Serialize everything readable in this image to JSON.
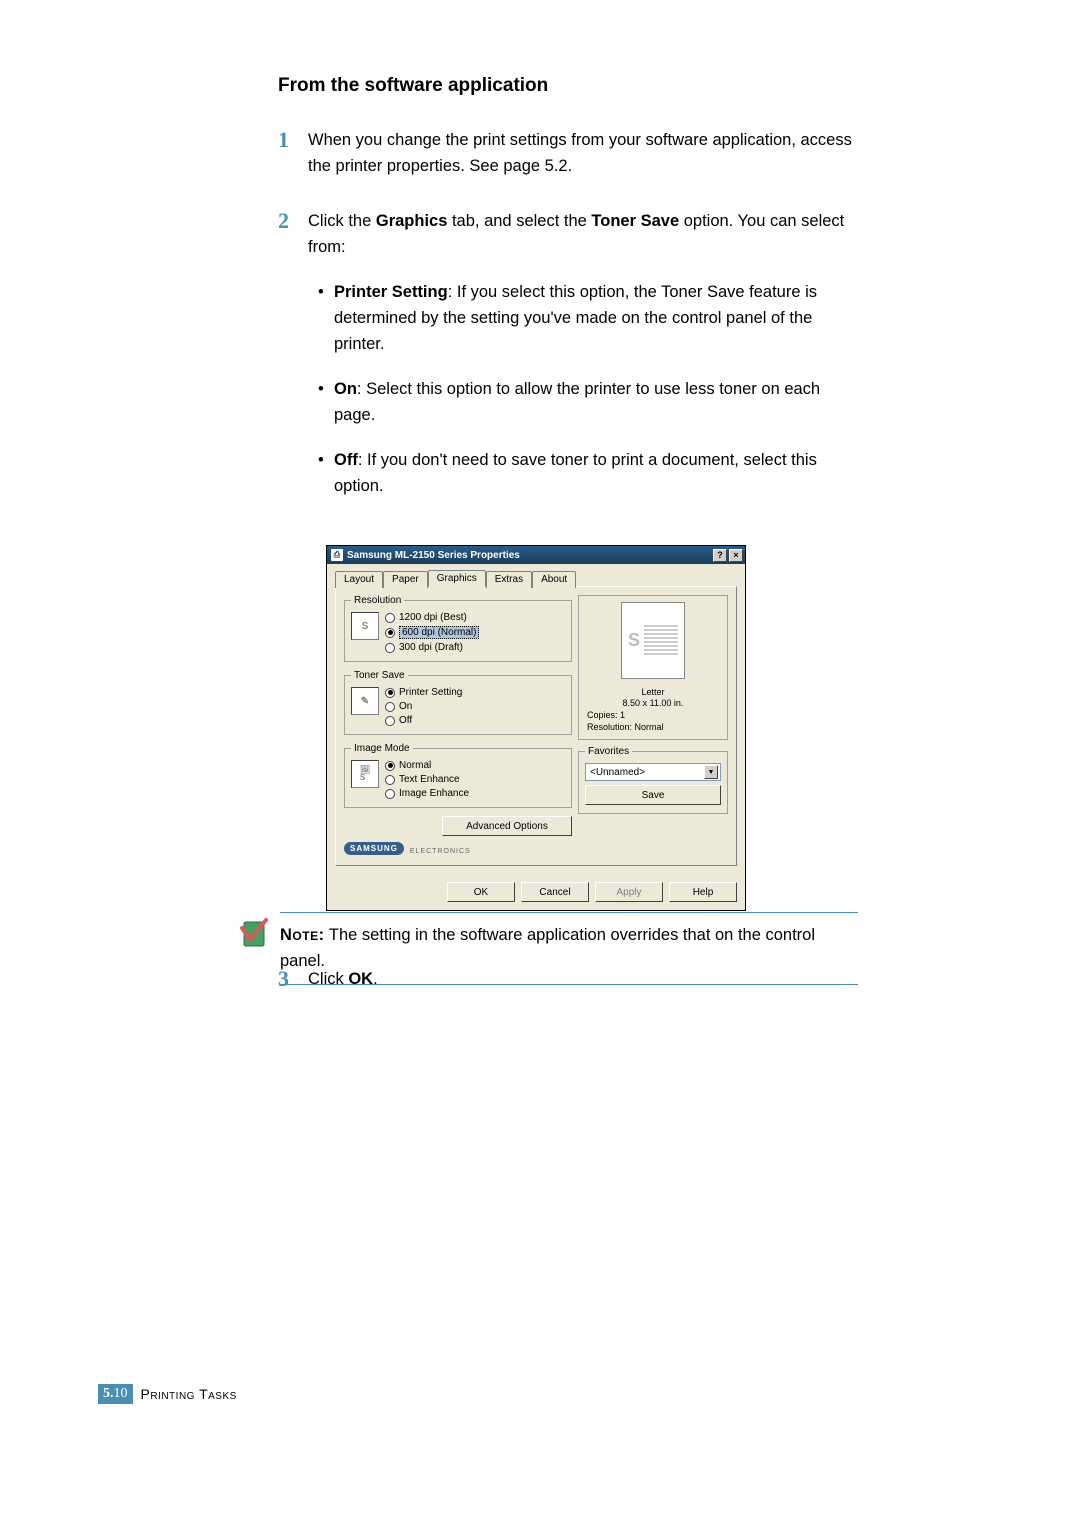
{
  "heading": "From the software application",
  "steps": {
    "s1": {
      "num": "1",
      "text": "When you change the print settings from your software application, access the printer properties. See page 5.2."
    },
    "s2": {
      "num": "2",
      "text_a": "Click the ",
      "text_b": "Graphics",
      "text_c": " tab, and select the ",
      "text_d": "Toner Save",
      "text_e": " option. You can select from:",
      "bullets": {
        "b1": {
          "label": "Printer Setting",
          "rest": ": If you select this option, the Toner Save feature is determined by the setting you've made on the control panel of the printer."
        },
        "b2": {
          "label": "On",
          "rest": ": Select this option to allow the printer to use less toner on each page."
        },
        "b3": {
          "label": "Off",
          "rest": ": If you don't need to save toner to print a document, select this option."
        }
      }
    },
    "s3": {
      "num": "3",
      "text_a": "Click ",
      "text_b": "OK",
      "text_c": "."
    }
  },
  "dialog": {
    "title": "Samsung ML-2150 Series Properties",
    "help_btn": "?",
    "close_btn": "×",
    "tabs": {
      "layout": "Layout",
      "paper": "Paper",
      "graphics": "Graphics",
      "extras": "Extras",
      "about": "About"
    },
    "groups": {
      "resolution": {
        "legend": "Resolution",
        "items": {
          "r1": "1200 dpi (Best)",
          "r2": "600 dpi (Normal)",
          "r3": "300 dpi (Draft)"
        }
      },
      "toner": {
        "legend": "Toner Save",
        "items": {
          "t1": "Printer Setting",
          "t2": "On",
          "t3": "Off"
        }
      },
      "image": {
        "legend": "Image Mode",
        "items": {
          "i1": "Normal",
          "i2": "Text Enhance",
          "i3": "Image Enhance"
        }
      }
    },
    "adv_options": "Advanced Options",
    "preview": {
      "paper": "Letter",
      "dims": "8.50 x 11.00 in.",
      "copies": "Copies: 1",
      "res": "Resolution: Normal"
    },
    "favorites": {
      "legend": "Favorites",
      "value": "<Unnamed>",
      "save": "Save"
    },
    "brand": {
      "name": "SAMSUNG",
      "sub": "ELECTRONICS"
    },
    "buttons": {
      "ok": "OK",
      "cancel": "Cancel",
      "apply": "Apply",
      "help": "Help"
    }
  },
  "note": {
    "label": "Note:",
    "text": " The setting in the software application overrides that on the control panel."
  },
  "footer": {
    "chapter": "5.",
    "page": "10",
    "title": "Printing Tasks"
  }
}
